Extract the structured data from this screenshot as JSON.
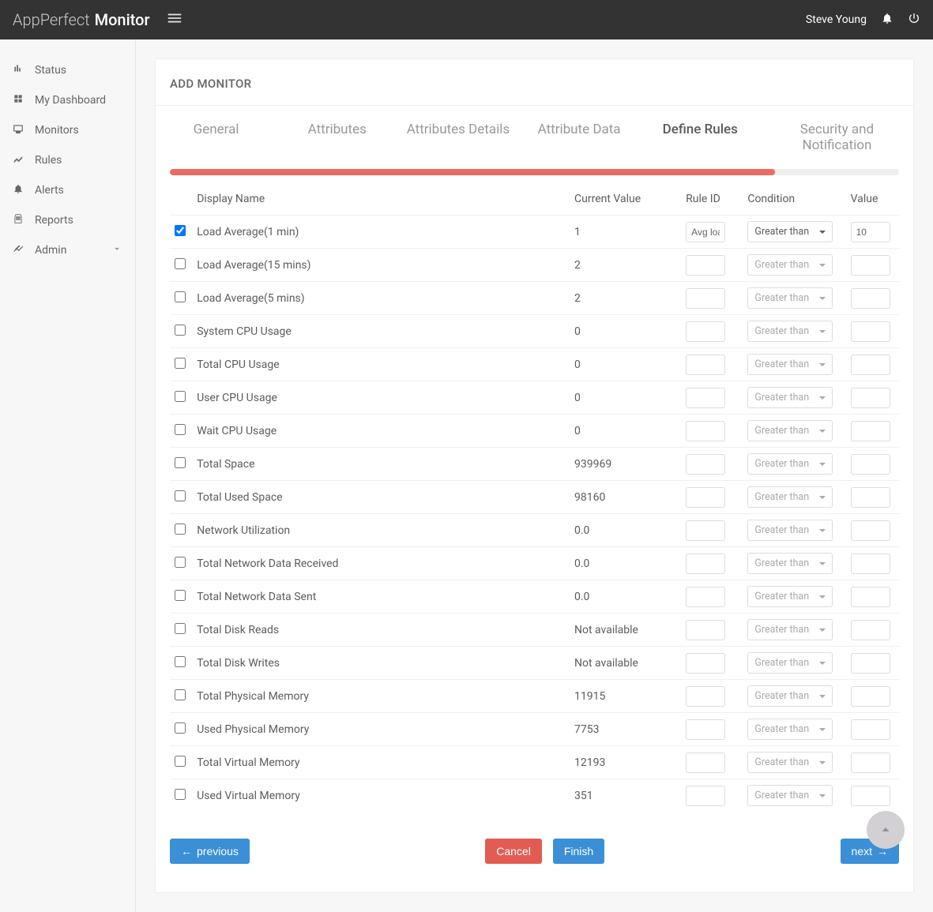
{
  "topbar": {
    "brand_light": "AppPerfect",
    "brand_bold": "Monitor",
    "user": "Steve Young"
  },
  "sidebar": {
    "items": [
      {
        "label": "Status",
        "icon": "status"
      },
      {
        "label": "My Dashboard",
        "icon": "dashboard"
      },
      {
        "label": "Monitors",
        "icon": "monitors"
      },
      {
        "label": "Rules",
        "icon": "rules"
      },
      {
        "label": "Alerts",
        "icon": "alerts"
      },
      {
        "label": "Reports",
        "icon": "reports"
      },
      {
        "label": "Admin",
        "icon": "admin",
        "expandable": true
      }
    ]
  },
  "page": {
    "title": "ADD MONITOR",
    "tabs": [
      "General",
      "Attributes",
      "Attributes Details",
      "Attribute Data",
      "Define Rules",
      "Security and Notification"
    ],
    "active_tab": 4,
    "progress_pct": 83
  },
  "table": {
    "headers": [
      "",
      "Display Name",
      "Current Value",
      "Rule ID",
      "Condition",
      "Value"
    ],
    "rows": [
      {
        "checked": true,
        "name": "Load Average(1 min)",
        "current": "1",
        "rule_id": "Avg loa",
        "condition": "Greater than",
        "value": "10"
      },
      {
        "checked": false,
        "name": "Load Average(15 mins)",
        "current": "2",
        "rule_id": "",
        "condition": "Greater than",
        "value": ""
      },
      {
        "checked": false,
        "name": "Load Average(5 mins)",
        "current": "2",
        "rule_id": "",
        "condition": "Greater than",
        "value": ""
      },
      {
        "checked": false,
        "name": "System CPU Usage",
        "current": "0",
        "rule_id": "",
        "condition": "Greater than",
        "value": ""
      },
      {
        "checked": false,
        "name": "Total CPU Usage",
        "current": "0",
        "rule_id": "",
        "condition": "Greater than",
        "value": ""
      },
      {
        "checked": false,
        "name": "User CPU Usage",
        "current": "0",
        "rule_id": "",
        "condition": "Greater than",
        "value": ""
      },
      {
        "checked": false,
        "name": "Wait CPU Usage",
        "current": "0",
        "rule_id": "",
        "condition": "Greater than",
        "value": ""
      },
      {
        "checked": false,
        "name": "Total Space",
        "current": "939969",
        "rule_id": "",
        "condition": "Greater than",
        "value": ""
      },
      {
        "checked": false,
        "name": "Total Used Space",
        "current": "98160",
        "rule_id": "",
        "condition": "Greater than",
        "value": ""
      },
      {
        "checked": false,
        "name": "Network Utilization",
        "current": "0.0",
        "rule_id": "",
        "condition": "Greater than",
        "value": ""
      },
      {
        "checked": false,
        "name": "Total Network Data Received",
        "current": "0.0",
        "rule_id": "",
        "condition": "Greater than",
        "value": ""
      },
      {
        "checked": false,
        "name": "Total Network Data Sent",
        "current": "0.0",
        "rule_id": "",
        "condition": "Greater than",
        "value": ""
      },
      {
        "checked": false,
        "name": "Total Disk Reads",
        "current": "Not available",
        "rule_id": "",
        "condition": "Greater than",
        "value": ""
      },
      {
        "checked": false,
        "name": "Total Disk Writes",
        "current": "Not available",
        "rule_id": "",
        "condition": "Greater than",
        "value": ""
      },
      {
        "checked": false,
        "name": "Total Physical Memory",
        "current": "11915",
        "rule_id": "",
        "condition": "Greater than",
        "value": ""
      },
      {
        "checked": false,
        "name": "Used Physical Memory",
        "current": "7753",
        "rule_id": "",
        "condition": "Greater than",
        "value": ""
      },
      {
        "checked": false,
        "name": "Total Virtual Memory",
        "current": "12193",
        "rule_id": "",
        "condition": "Greater than",
        "value": ""
      },
      {
        "checked": false,
        "name": "Used Virtual Memory",
        "current": "351",
        "rule_id": "",
        "condition": "Greater than",
        "value": ""
      }
    ]
  },
  "actions": {
    "previous": "previous",
    "cancel": "Cancel",
    "finish": "Finish",
    "next": "next"
  }
}
